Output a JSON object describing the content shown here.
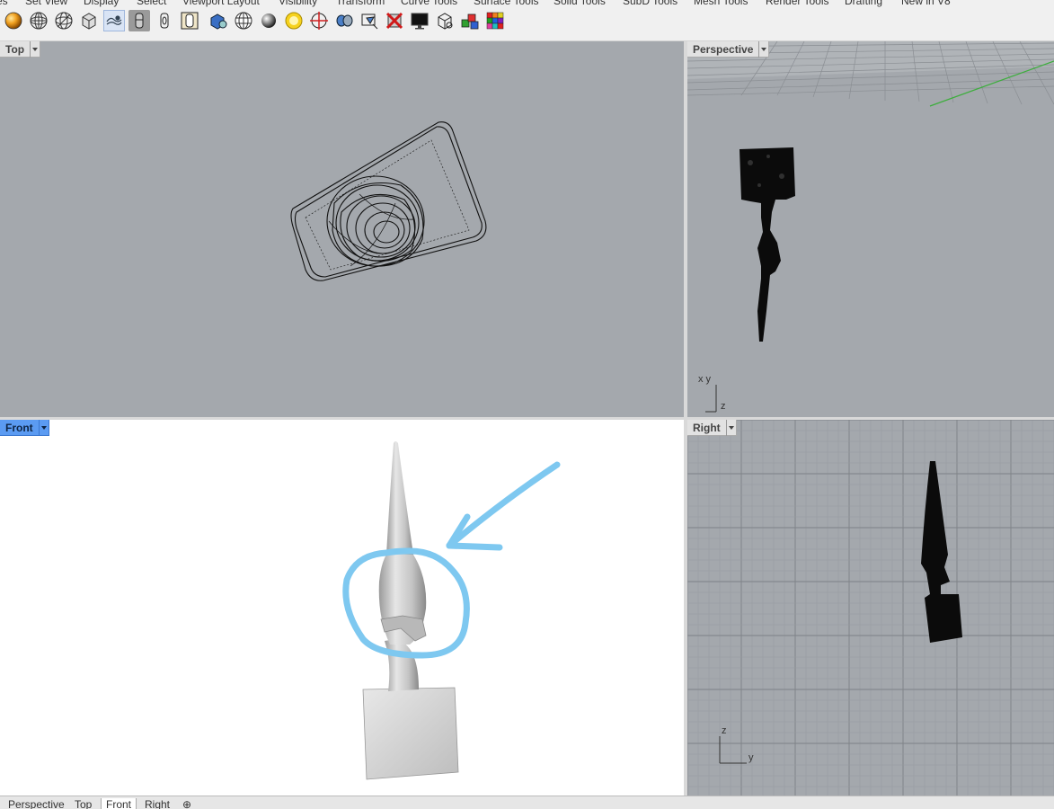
{
  "menu_tabs": [
    "es",
    "Set View",
    "Display",
    "Select",
    "Viewport Layout",
    "Visibility",
    "Transform",
    "Curve Tools",
    "Surface Tools",
    "Solid Tools",
    "SubD Tools",
    "Mesh Tools",
    "Render Tools",
    "Drafting",
    "New in V8"
  ],
  "active_menu_tab": "Display",
  "toolbar_icons": [
    "rendered-sphere-icon",
    "wireframe-sphere-icon",
    "wireframe-sphere-x-icon",
    "shaded-box-icon",
    "capture-view-icon",
    "ghosted-object-icon",
    "xray-object-icon",
    "technical-object-icon",
    "shaded-blue-box-icon",
    "grid-sphere-icon",
    "shaded-sphere-icon",
    "yellow-light-icon",
    "target-crosshair-icon",
    "lens-icon",
    "view-capture-icon",
    "delete-red-x-icon",
    "monitor-icon",
    "box-outline-icon",
    "colored-cubes-icon",
    "color-palette-grid-icon"
  ],
  "viewports": {
    "top": {
      "label": "Top"
    },
    "perspective": {
      "label": "Perspective",
      "axis": "x y",
      "axis_z": "z"
    },
    "front": {
      "label": "Front"
    },
    "right": {
      "label": "Right",
      "axis_z": "z",
      "axis_y": "y"
    }
  },
  "view_tabs": [
    "Perspective",
    "Top",
    "Front",
    "Right"
  ],
  "selected_view_tab": "Front",
  "add_tab_symbol": "⊕",
  "colors": {
    "active_label": "#5b9bf2",
    "annotation": "#7ec8f0",
    "grid_line_green": "#3cae3c"
  }
}
